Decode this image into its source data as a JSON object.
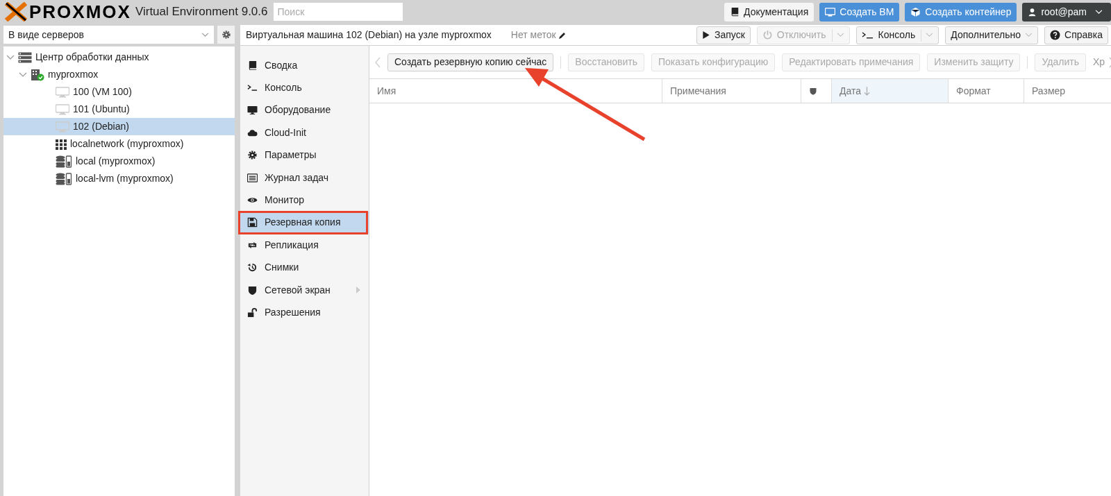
{
  "topbar": {
    "logo": "PROXMOX",
    "product": "Virtual Environment 9.0.6",
    "search": {
      "placeholder": "Поиск"
    },
    "buttons": [
      {
        "kind": "docs",
        "label": "Документация"
      },
      {
        "kind": "create-vm",
        "label": "Создать ВМ"
      },
      {
        "kind": "create-ct",
        "label": "Создать контейнер"
      },
      {
        "kind": "user",
        "label": "root@pam"
      }
    ]
  },
  "sidebar": {
    "view_select": "В виде серверов",
    "tree": [
      {
        "kind": "datacenter",
        "label": "Центр обработки данных",
        "expanded": true,
        "selected": false,
        "children": [
          {
            "kind": "node",
            "label": "myproxmox",
            "expanded": true,
            "selected": false,
            "online": true,
            "children": [
              {
                "kind": "vm",
                "label": "100 (VM 100)",
                "selected": false
              },
              {
                "kind": "vm",
                "label": "101 (Ubuntu)",
                "selected": false
              },
              {
                "kind": "vm",
                "label": "102 (Debian)",
                "selected": true
              },
              {
                "kind": "sdn",
                "label": "localnetwork (myproxmox)",
                "selected": false
              },
              {
                "kind": "storage",
                "label": "local (myproxmox)",
                "selected": false
              },
              {
                "kind": "storage",
                "label": "local-lvm (myproxmox)",
                "selected": false
              }
            ]
          }
        ]
      }
    ]
  },
  "header": {
    "title": "Виртуальная машина 102 (Debian) на узле myproxmox",
    "tags": "Нет меток",
    "buttons": [
      {
        "kind": "start",
        "label": "Запуск",
        "disabled": false,
        "split": false
      },
      {
        "kind": "shutdown",
        "label": "Отключить",
        "disabled": true,
        "split": true
      },
      {
        "kind": "console",
        "label": "Консоль",
        "disabled": false,
        "split": true
      },
      {
        "kind": "more",
        "label": "Дополнительно",
        "disabled": false,
        "split": false,
        "dropdown": true
      },
      {
        "kind": "help",
        "label": "Справка",
        "disabled": false,
        "split": false
      }
    ]
  },
  "nav": [
    {
      "kind": "book",
      "label": "Сводка",
      "selected": false
    },
    {
      "kind": "terminal",
      "label": "Консоль",
      "selected": false
    },
    {
      "kind": "desktop",
      "label": "Оборудование",
      "selected": false
    },
    {
      "kind": "cloud",
      "label": "Cloud-Init",
      "selected": false
    },
    {
      "kind": "gear",
      "label": "Параметры",
      "selected": false
    },
    {
      "kind": "list",
      "label": "Журнал задач",
      "selected": false
    },
    {
      "kind": "eye",
      "label": "Монитор",
      "selected": false
    },
    {
      "kind": "floppy",
      "label": "Резервная копия",
      "selected": true,
      "highlighted": true
    },
    {
      "kind": "retweet",
      "label": "Репликация",
      "selected": false
    },
    {
      "kind": "history",
      "label": "Снимки",
      "selected": false
    },
    {
      "kind": "shield",
      "label": "Сетевой экран",
      "selected": false,
      "submenu": true
    },
    {
      "kind": "unlock",
      "label": "Разрешения",
      "selected": false
    }
  ],
  "toolbar": {
    "items": [
      {
        "kind": "button",
        "label": "Создать резервную копию сейчас",
        "disabled": false
      },
      {
        "kind": "separator"
      },
      {
        "kind": "button",
        "label": "Восстановить",
        "disabled": true
      },
      {
        "kind": "button",
        "label": "Показать конфигурацию",
        "disabled": true
      },
      {
        "kind": "button",
        "label": "Редактировать примечания",
        "disabled": true
      },
      {
        "kind": "button",
        "label": "Изменить защиту",
        "disabled": true
      },
      {
        "kind": "separator"
      },
      {
        "kind": "button",
        "label": "Удалить",
        "disabled": true
      }
    ],
    "overflow_label": "Хр"
  },
  "table": {
    "columns": [
      {
        "kind": "text",
        "label": "Имя",
        "sorted": false
      },
      {
        "kind": "text",
        "label": "Примечания",
        "sorted": false
      },
      {
        "kind": "shield",
        "sorted": false
      },
      {
        "kind": "text",
        "label": "Дата",
        "sorted": true
      },
      {
        "kind": "text",
        "label": "Формат",
        "sorted": false
      },
      {
        "kind": "text",
        "label": "Размер",
        "sorted": false
      }
    ]
  },
  "annotations": [
    {
      "kind": "arrow"
    }
  ]
}
